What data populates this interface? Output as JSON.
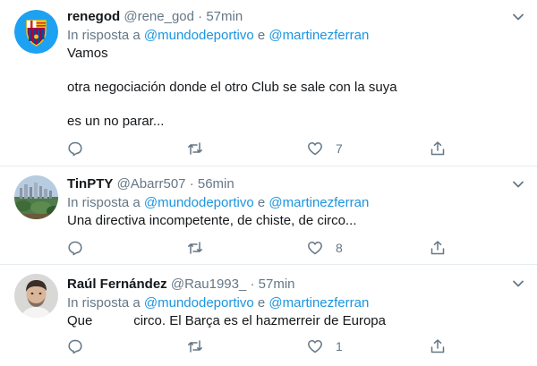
{
  "tweets": [
    {
      "name": "renegod",
      "handle": "@rene_god",
      "sep": "·",
      "time": "57min",
      "reply_prefix": "In risposta a",
      "mention1": "@mundodeportivo",
      "conj": "e",
      "mention2": "@martinezferran",
      "lines": [
        "Vamos",
        "otra negociación donde el otro Club se sale con la suya",
        "es un no parar..."
      ],
      "likes": "7"
    },
    {
      "name": "TinPTY",
      "handle": "@Abarr507",
      "sep": "·",
      "time": "56min",
      "reply_prefix": "In risposta a",
      "mention1": "@mundodeportivo",
      "conj": "e",
      "mention2": "@martinezferran",
      "lines": [
        "Una directiva incompetente, de chiste, de circo..."
      ],
      "likes": "8"
    },
    {
      "name": "Raúl Fernández",
      "handle": "@Rau1993_",
      "sep": "·",
      "time": "57min",
      "reply_prefix": "In risposta a",
      "mention1": "@mundodeportivo",
      "conj": "e",
      "mention2": "@martinezferran",
      "lines": [
        "Que           circo. El Barça es el hazmerreir de Europa"
      ],
      "likes": "1"
    }
  ],
  "colors": {
    "name": "#14171a",
    "muted": "#657786",
    "link": "#1b95e0",
    "divider": "#e6ecf0"
  },
  "icons": {
    "reply": "reply-icon",
    "retweet": "retweet-icon",
    "like": "heart-icon",
    "share": "share-icon",
    "menu": "chevron-down-icon"
  }
}
